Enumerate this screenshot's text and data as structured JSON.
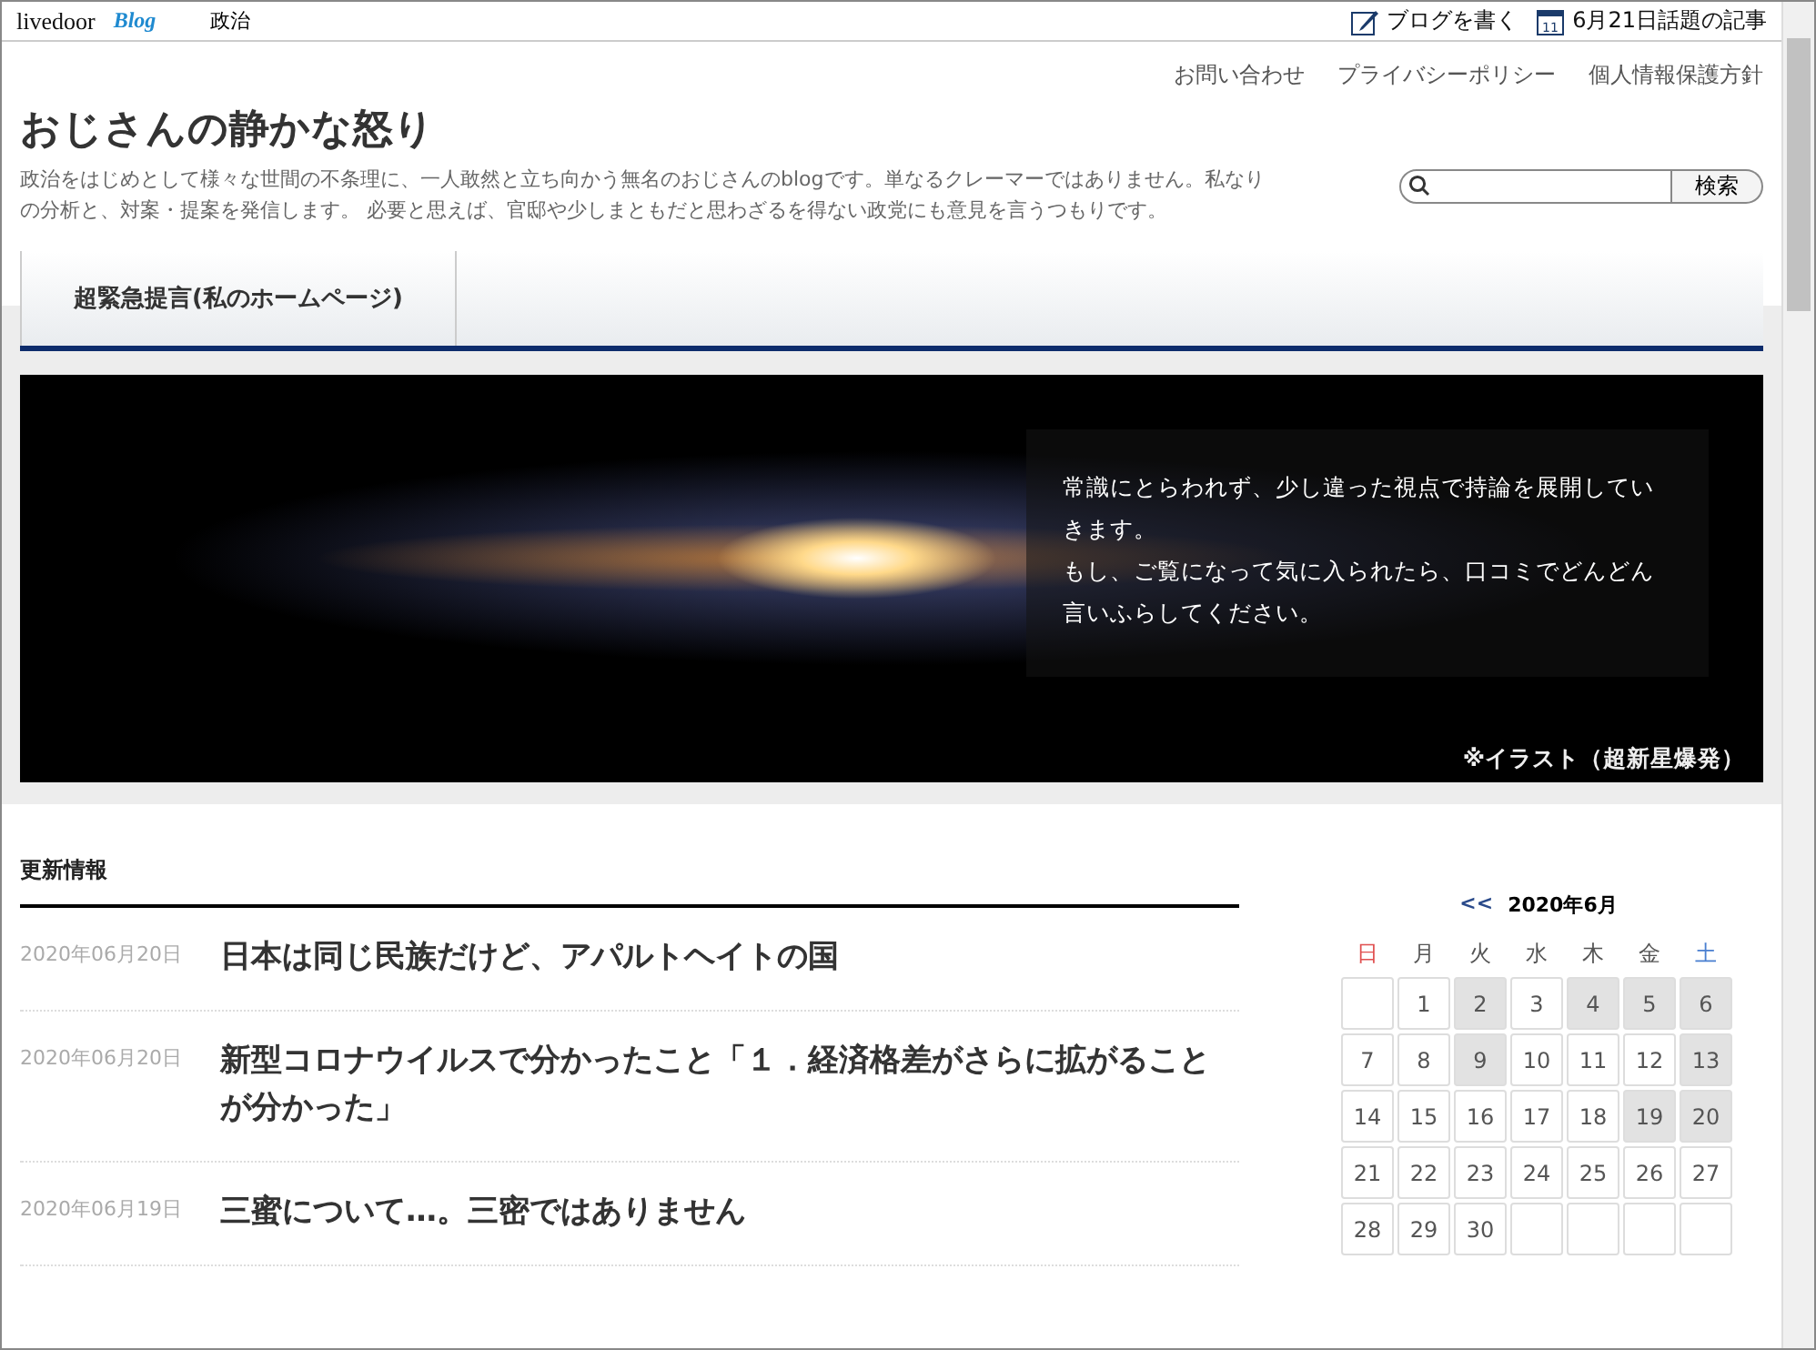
{
  "topbar": {
    "logo": "livedoor",
    "logo_sub": "Blog",
    "category": "政治",
    "actions": [
      {
        "kind": "write",
        "label": "ブログを書く"
      },
      {
        "kind": "calendar",
        "label": "6月21日話題の記事",
        "icon_text": "11"
      }
    ]
  },
  "header": {
    "links": [
      "お問い合わせ",
      "プライバシーポリシー",
      "個人情報保護方針"
    ],
    "title": "おじさんの静かな怒り",
    "description": "政治をはじめとして様々な世間の不条理に、一人敢然と立ち向かう無名のおじさんのblogです。単なるクレーマーではありません。私なりの分析と、対案・提案を発信します。 必要と思えば、官邸や少しまともだと思わざるを得ない政党にも意見を言うつもりです。",
    "search": {
      "button": "検索"
    }
  },
  "nav": {
    "tabs": [
      {
        "label": "超緊急提言(私のホームページ)",
        "selected": true
      }
    ]
  },
  "banner": {
    "message": [
      "常識にとらわれず、少し違った視点で持論を展開していきます。",
      "もし、ご覧になって気に入られたら、口コミでどんどん言いふらしてください。"
    ],
    "caption": "※イラスト（超新星爆発）"
  },
  "updates": {
    "heading": "更新情報",
    "posts": [
      {
        "date": "2020年06月20日",
        "title": "日本は同じ民族だけど、アパルトヘイトの国"
      },
      {
        "date": "2020年06月20日",
        "title": "新型コロナウイルスで分かったこと「１．経済格差がさらに拡がることが分かった」"
      },
      {
        "date": "2020年06月19日",
        "title": "三蜜について…。三密ではありません"
      }
    ]
  },
  "calendar": {
    "prev": "<<",
    "month": "2020年6月",
    "weekdays": [
      {
        "label": "日",
        "color": "#e05050"
      },
      {
        "label": "月",
        "color": "#555555"
      },
      {
        "label": "火",
        "color": "#555555"
      },
      {
        "label": "水",
        "color": "#555555"
      },
      {
        "label": "木",
        "color": "#555555"
      },
      {
        "label": "金",
        "color": "#555555"
      },
      {
        "label": "土",
        "color": "#4a7fd0"
      }
    ],
    "weeks": [
      [
        {
          "kind": "empty"
        },
        {
          "kind": "day",
          "day": "1",
          "highlighted": false
        },
        {
          "kind": "day",
          "day": "2",
          "highlighted": true
        },
        {
          "kind": "day",
          "day": "3",
          "highlighted": false
        },
        {
          "kind": "day",
          "day": "4",
          "highlighted": true
        },
        {
          "kind": "day",
          "day": "5",
          "highlighted": true
        },
        {
          "kind": "day",
          "day": "6",
          "highlighted": true
        }
      ],
      [
        {
          "kind": "day",
          "day": "7",
          "highlighted": false
        },
        {
          "kind": "day",
          "day": "8",
          "highlighted": false
        },
        {
          "kind": "day",
          "day": "9",
          "highlighted": true
        },
        {
          "kind": "day",
          "day": "10",
          "highlighted": false
        },
        {
          "kind": "day",
          "day": "11",
          "highlighted": false
        },
        {
          "kind": "day",
          "day": "12",
          "highlighted": false
        },
        {
          "kind": "day",
          "day": "13",
          "highlighted": true
        }
      ],
      [
        {
          "kind": "day",
          "day": "14",
          "highlighted": false
        },
        {
          "kind": "day",
          "day": "15",
          "highlighted": false
        },
        {
          "kind": "day",
          "day": "16",
          "highlighted": false
        },
        {
          "kind": "day",
          "day": "17",
          "highlighted": false
        },
        {
          "kind": "day",
          "day": "18",
          "highlighted": false
        },
        {
          "kind": "day",
          "day": "19",
          "highlighted": true
        },
        {
          "kind": "day",
          "day": "20",
          "highlighted": true
        }
      ],
      [
        {
          "kind": "day",
          "day": "21",
          "highlighted": false
        },
        {
          "kind": "day",
          "day": "22",
          "highlighted": false
        },
        {
          "kind": "day",
          "day": "23",
          "highlighted": false
        },
        {
          "kind": "day",
          "day": "24",
          "highlighted": false
        },
        {
          "kind": "day",
          "day": "25",
          "highlighted": false
        },
        {
          "kind": "day",
          "day": "26",
          "highlighted": false
        },
        {
          "kind": "day",
          "day": "27",
          "highlighted": false
        }
      ],
      [
        {
          "kind": "day",
          "day": "28",
          "highlighted": false
        },
        {
          "kind": "day",
          "day": "29",
          "highlighted": false
        },
        {
          "kind": "day",
          "day": "30",
          "highlighted": false
        },
        {
          "kind": "empty"
        },
        {
          "kind": "empty"
        },
        {
          "kind": "empty"
        },
        {
          "kind": "empty"
        }
      ]
    ]
  }
}
